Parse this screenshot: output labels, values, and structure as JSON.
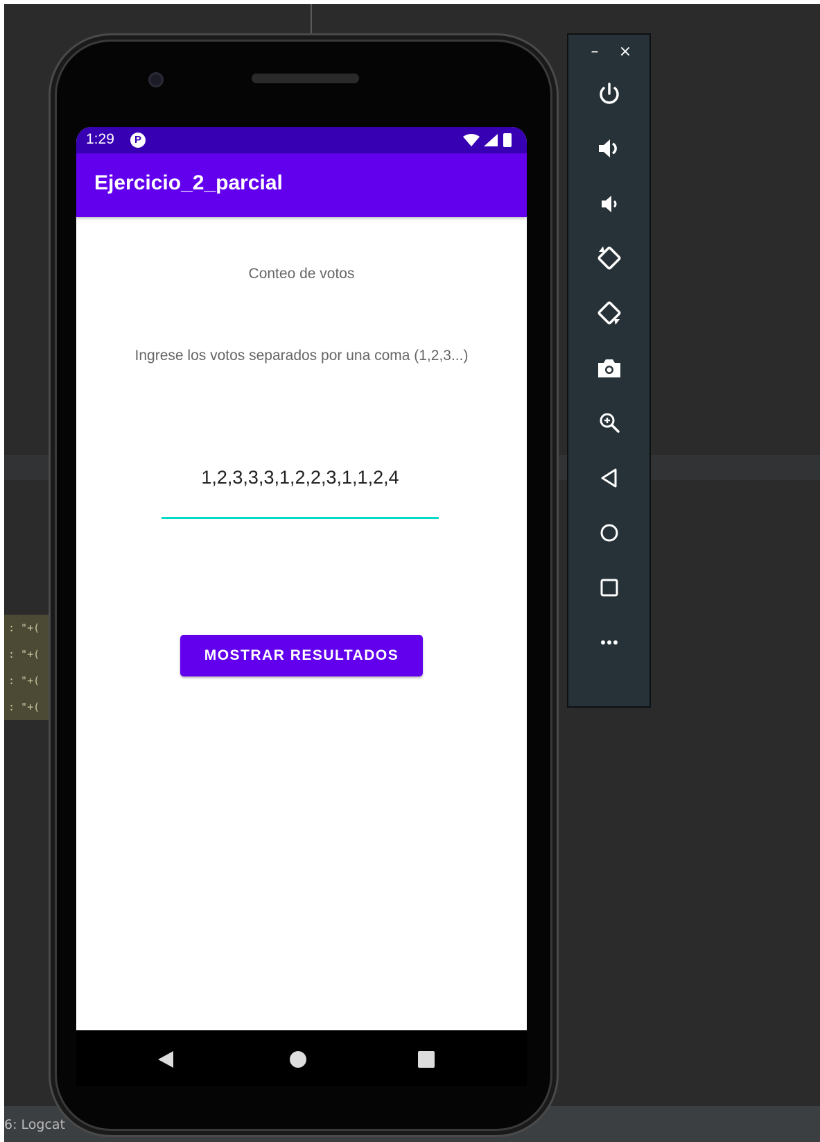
{
  "ide": {
    "code_lines": [
      ": \"+(",
      ": \"+(",
      ": \"+(",
      ": \"+("
    ],
    "statusbar_label": "6: Logcat"
  },
  "device": {
    "status_time": "1:29",
    "status_notification_glyph": "P",
    "colors": {
      "status_bar": "#3700b3",
      "app_bar": "#6200ee",
      "accent": "#03dac5",
      "button": "#6200ee"
    }
  },
  "app": {
    "title": "Ejercicio_2_parcial",
    "heading": "Conteo de votos",
    "instructions": "Ingrese los votos separados por una coma (1,2,3...)",
    "votes_input_value": "1,2,3,3,3,1,2,2,3,1,1,2,4",
    "show_results_label": "MOSTRAR RESULTADOS"
  },
  "nav": {
    "back": "back-triangle-icon",
    "home": "home-circle-icon",
    "recents": "recents-square-icon"
  },
  "emulator_toolbar": {
    "minimize_label": "–",
    "close_label": "×",
    "buttons": [
      "power",
      "volume-up",
      "volume-down",
      "rotate-left",
      "rotate-right",
      "screenshot",
      "zoom",
      "back",
      "home",
      "overview",
      "more"
    ]
  }
}
